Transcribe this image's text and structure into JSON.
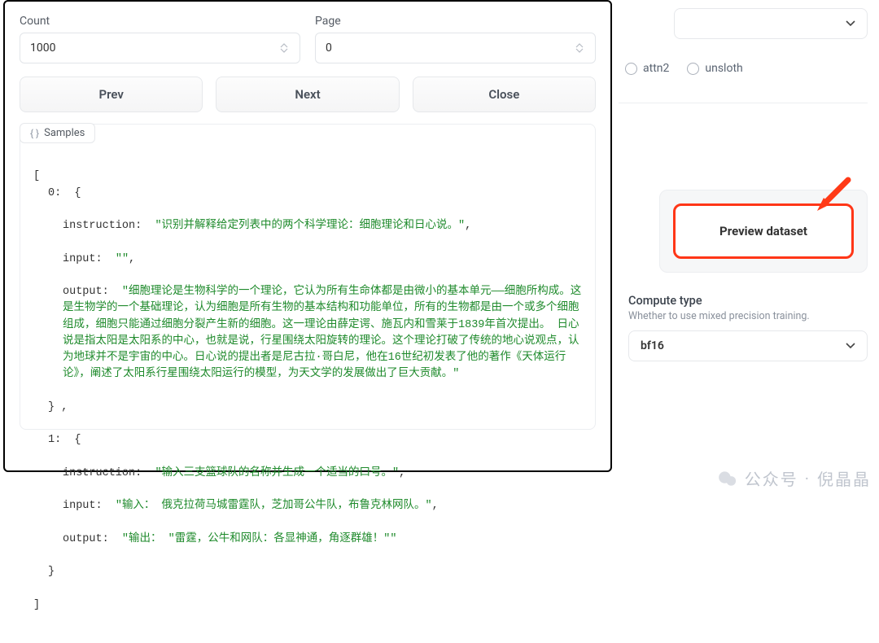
{
  "modal": {
    "count_label": "Count",
    "count_value": "1000",
    "page_label": "Page",
    "page_value": "0",
    "prev": "Prev",
    "next": "Next",
    "close": "Close",
    "tab_label": "Samples",
    "items": [
      {
        "instruction": "识别并解释给定列表中的两个科学理论：细胞理论和日心说。",
        "input": "",
        "output": "细胞理论是生物科学的一个理论，它认为所有生命体都是由微小的基本单元——细胞所构成。这是生物学的一个基础理论，认为细胞是所有生物的基本结构和功能单位，所有的生物都是由一个或多个细胞组成，细胞只能通过细胞分裂产生新的细胞。这一理论由薛定谔、施瓦内和雪莱于1839年首次提出。 日心说是指太阳是太阳系的中心，也就是说，行星围绕太阳旋转的理论。这个理论打破了传统的地心说观点，认为地球并不是宇宙的中心。日心说的提出者是尼古拉·哥白尼，他在16世纪初发表了他的著作《天体运行论》，阐述了太阳系行星围绕太阳运行的模型，为天文学的发展做出了巨大贡献。"
      },
      {
        "instruction": "输入三支篮球队的名称并生成一个适当的口号。",
        "input": "输入： 俄克拉荷马城雷霆队，芝加哥公牛队，布鲁克林网队。",
        "output": "输出： \"雷霆，公牛和网队：各显神通，角逐群雄！\""
      }
    ],
    "keys": {
      "instruction": "instruction",
      "input": "input",
      "output": "output"
    }
  },
  "right": {
    "radio_attn2": "attn2",
    "radio_unsloth": "unsloth",
    "preview_btn": "Preview dataset",
    "compute_title": "Compute type",
    "compute_sub": "Whether to use mixed precision training.",
    "compute_value": "bf16"
  },
  "watermark": {
    "prefix": "公众号",
    "dot": "·",
    "name": "倪晶晶"
  }
}
